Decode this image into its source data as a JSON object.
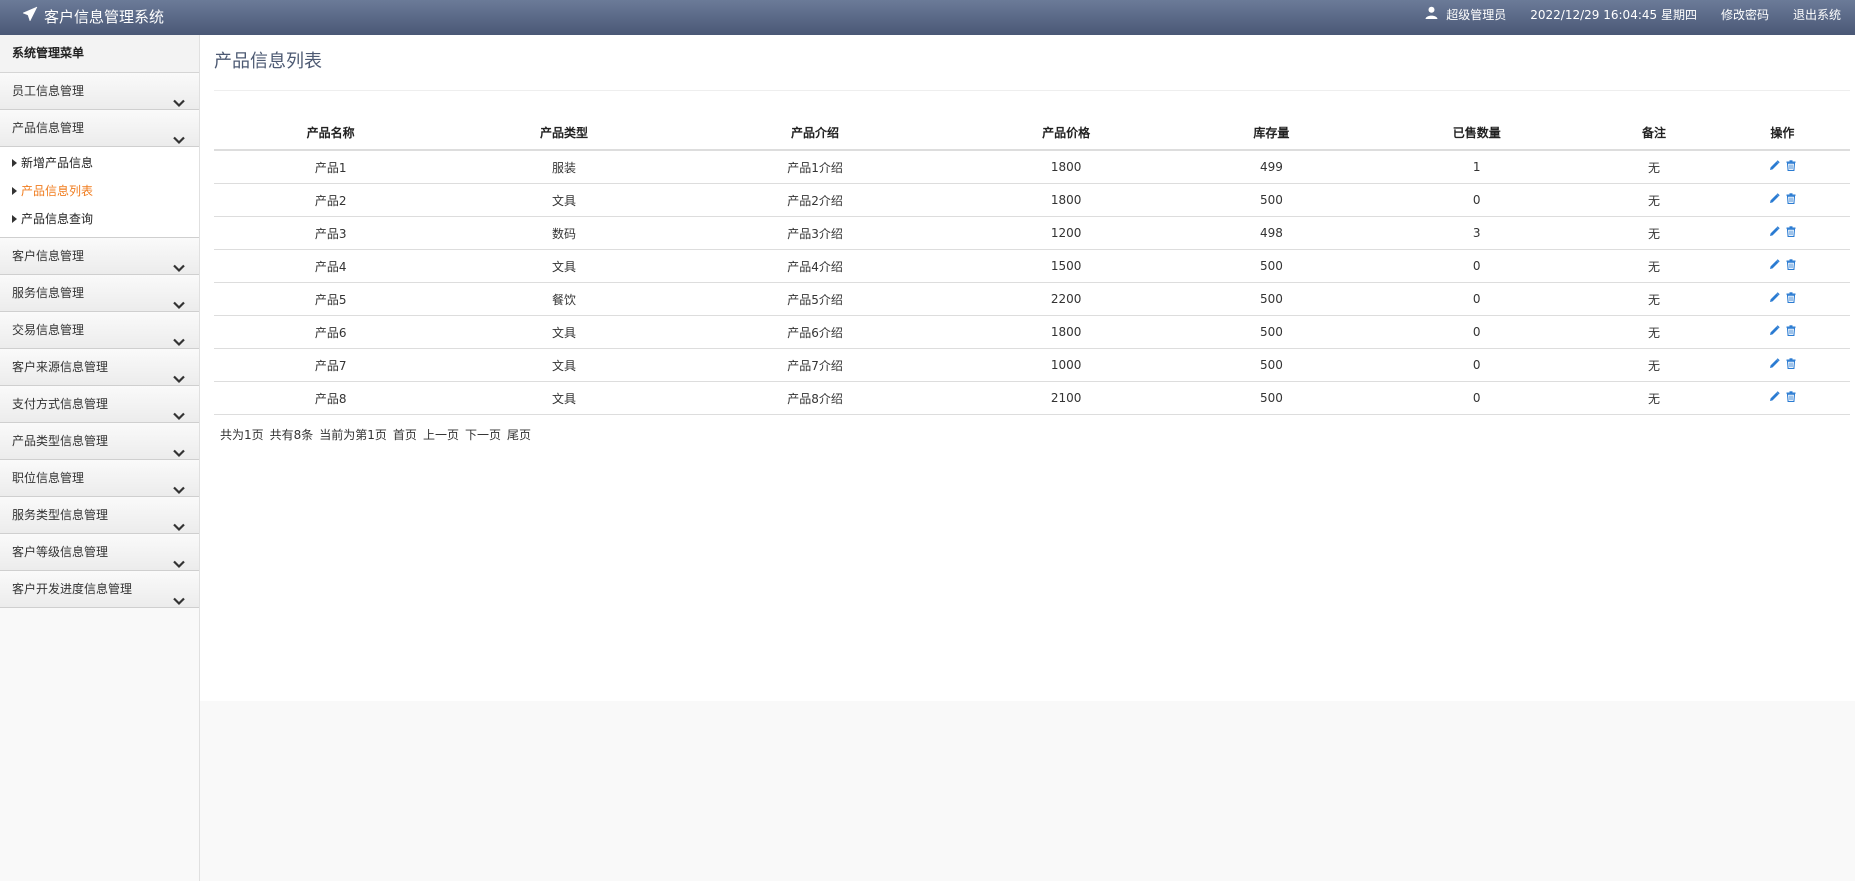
{
  "app": {
    "title": "客户信息管理系统"
  },
  "topbar": {
    "user": "超级管理员",
    "datetime": "2022/12/29 16:04:45 星期四",
    "change_password": "修改密码",
    "logout": "退出系统"
  },
  "sidebar": {
    "title": "系统管理菜单",
    "group_employee": "员工信息管理",
    "group_product": "产品信息管理",
    "sub_add": "新增产品信息",
    "sub_list": "产品信息列表",
    "sub_query": "产品信息查询",
    "group_customer": "客户信息管理",
    "group_service": "服务信息管理",
    "group_trade": "交易信息管理",
    "group_source": "客户来源信息管理",
    "group_payment": "支付方式信息管理",
    "group_product_type": "产品类型信息管理",
    "group_position": "职位信息管理",
    "group_service_type": "服务类型信息管理",
    "group_level": "客户等级信息管理",
    "group_progress": "客户开发进度信息管理"
  },
  "main": {
    "title": "产品信息列表",
    "columns": [
      "产品名称",
      "产品类型",
      "产品介绍",
      "产品价格",
      "库存量",
      "已售数量",
      "备注",
      "操作"
    ],
    "rows": [
      [
        "产品1",
        "服装",
        "产品1介绍",
        "1800",
        "499",
        "1",
        "无"
      ],
      [
        "产品2",
        "文具",
        "产品2介绍",
        "1800",
        "500",
        "0",
        "无"
      ],
      [
        "产品3",
        "数码",
        "产品3介绍",
        "1200",
        "498",
        "3",
        "无"
      ],
      [
        "产品4",
        "文具",
        "产品4介绍",
        "1500",
        "500",
        "0",
        "无"
      ],
      [
        "产品5",
        "餐饮",
        "产品5介绍",
        "2200",
        "500",
        "0",
        "无"
      ],
      [
        "产品6",
        "文具",
        "产品6介绍",
        "1800",
        "500",
        "0",
        "无"
      ],
      [
        "产品7",
        "文具",
        "产品7介绍",
        "1000",
        "500",
        "0",
        "无"
      ],
      [
        "产品8",
        "文具",
        "产品8介绍",
        "2100",
        "500",
        "0",
        "无"
      ]
    ]
  },
  "pager": {
    "total_pages": "共为1页",
    "total_items": "共有8条",
    "current": "当前为第1页",
    "first": "首页",
    "prev": "上一页",
    "next": "下一页",
    "last": "尾页"
  },
  "colors": {
    "accent": "#4a5876",
    "active": "#f07c1e",
    "icon": "#2a7bd2"
  }
}
